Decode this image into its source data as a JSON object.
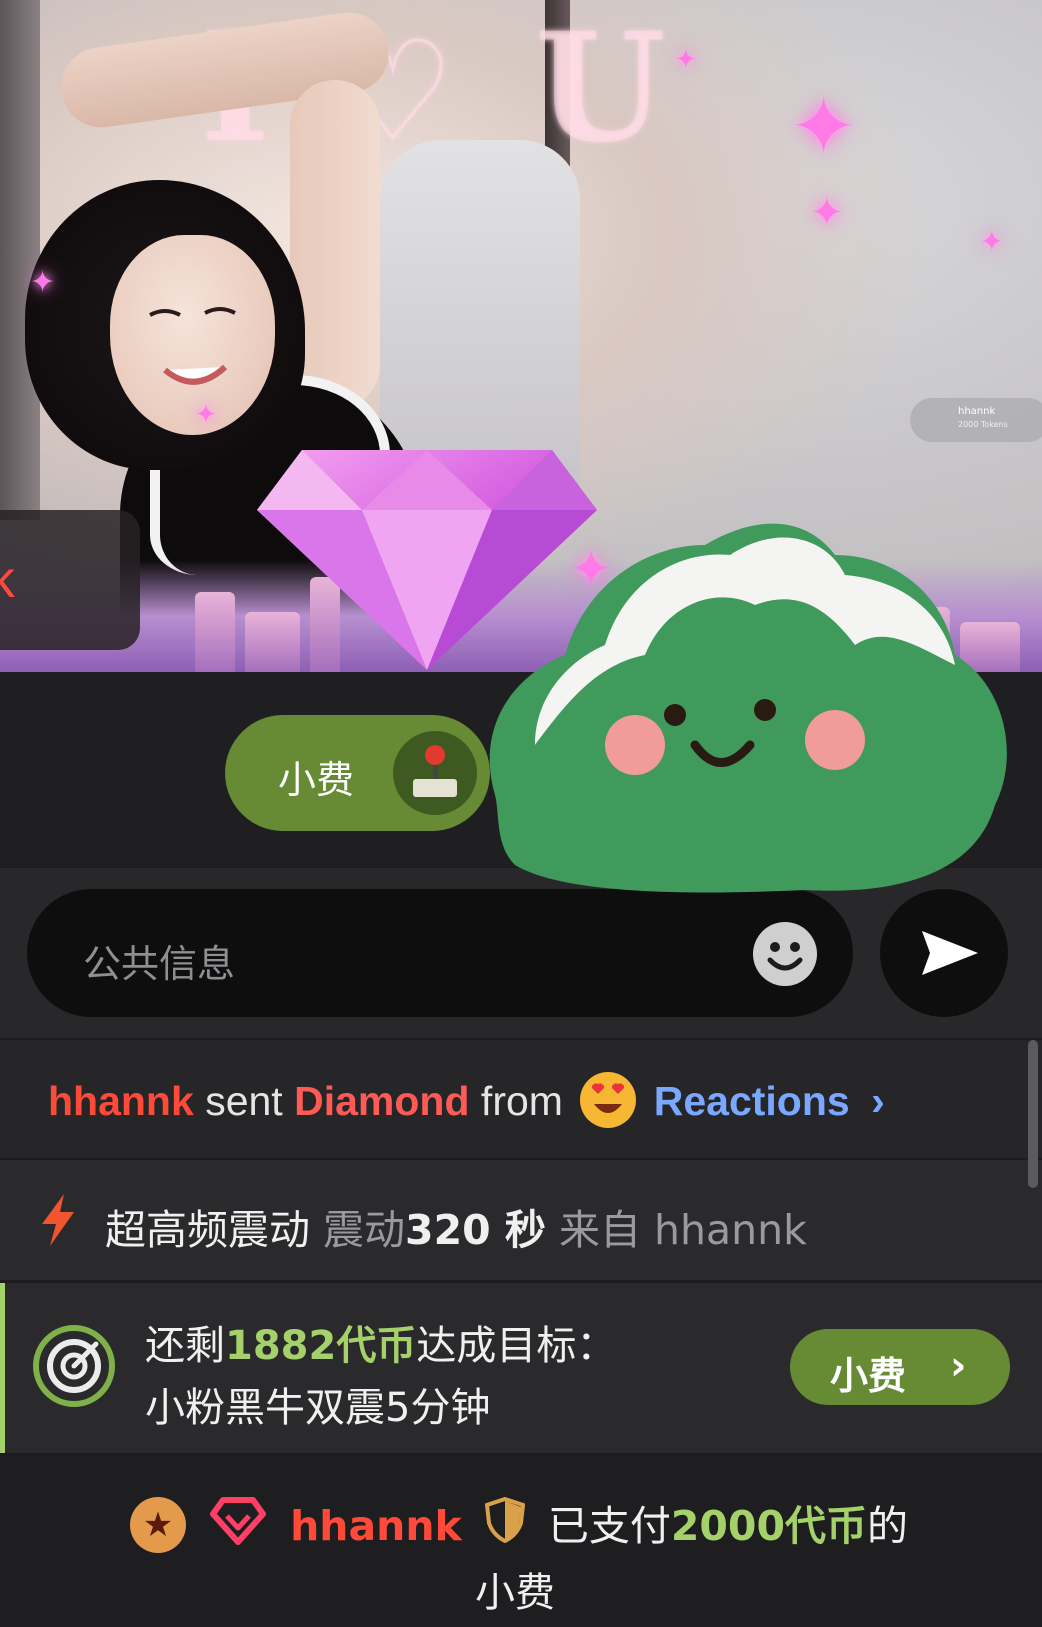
{
  "stream": {
    "overlay_username": "nk",
    "chip_username": "hhannk",
    "chip_subtext": "2000 Tokens"
  },
  "tip_button": {
    "label": "小费"
  },
  "message_input": {
    "placeholder": "公共信息"
  },
  "feed": {
    "gift": {
      "user": "hhannk",
      "sent": "sent",
      "gift_name": "Diamond",
      "from": "from",
      "source": "Reactions",
      "chevron": "›"
    },
    "vibe": {
      "title": "超高频震动",
      "action": "震动",
      "duration": "320 秒",
      "from": "来自",
      "user": "hhannk"
    },
    "goal": {
      "prefix": "还剩",
      "amount": "1882代币",
      "suffix": "达成目标：",
      "goal_text": "小粉黑牛双震5分钟",
      "button_label": "小费",
      "button_chevron": "›"
    },
    "tip": {
      "user": "hhannk",
      "paid": "已支付",
      "amount": "2000代币",
      "of": "的",
      "kind": "小费"
    }
  },
  "colors": {
    "accent_green": "#678a34",
    "highlight_green": "#a4d16a",
    "username_red": "#ff4a3a",
    "link_blue": "#7aa7ff"
  }
}
